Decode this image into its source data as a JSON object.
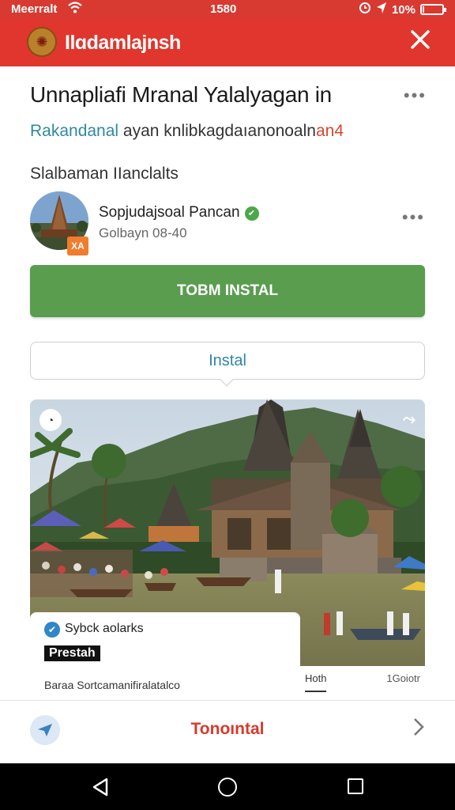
{
  "status_bar": {
    "carrier": "Meerralt",
    "time": "1580",
    "battery": "10%",
    "battery_level": 0.1,
    "icons": [
      "wifi-icon",
      "alarm-icon",
      "location-icon",
      "battery-icon"
    ]
  },
  "app_bar": {
    "title": "Ilɑdamlajnsh",
    "logo_icon": "emblem-icon",
    "close_icon": "close-icon",
    "background": "#e0362d"
  },
  "headline": {
    "title": "Unnapliafi Mranal Yalalyagan in",
    "sub_accent": "Rakandanal",
    "sub_main": " ayan knlibkagdaıanonoaln",
    "sub_tail": "an4"
  },
  "section": {
    "label": "Slalbaman IIanclalts"
  },
  "profile": {
    "name": "Sopjudajsoal Pancan",
    "subtitle": "Golbayn 08-40",
    "badge": "XA",
    "verified_icon": "verified-icon"
  },
  "buttons": {
    "primary": "TOBM INSTAL",
    "secondary": "Instal",
    "primary_color": "#5a9d4f",
    "secondary_color": "#2e86a8"
  },
  "media": {
    "overlay_title": "Sybck aolarks",
    "overlay_tag": "Prestah",
    "overlay_caption": "Baraa Sortcamanifiralatalco",
    "side_tab": "Hoth",
    "side_stat": "1Goiotr"
  },
  "bottom_bar": {
    "label": "Tonoıntal",
    "send_icon": "send-icon",
    "chevron_icon": "chevron-right-icon",
    "accent": "#d9392d"
  },
  "nav": {
    "icons": [
      "back-icon",
      "home-icon",
      "recents-icon"
    ]
  }
}
